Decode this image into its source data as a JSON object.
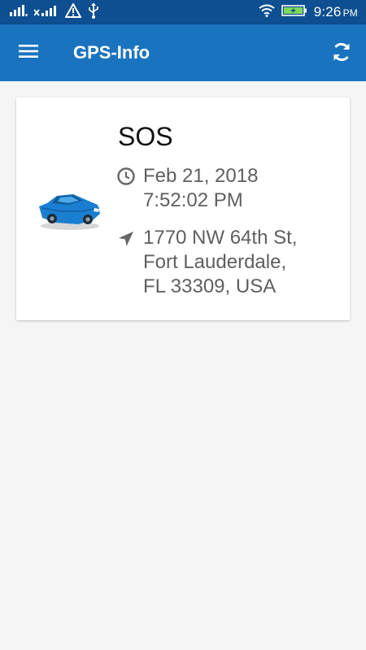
{
  "status_bar": {
    "time": "9:26",
    "ampm": "PM",
    "icons": [
      "signal-icon",
      "signal-x-icon",
      "warning-icon",
      "usb-icon",
      "wifi-icon",
      "battery-charging-icon"
    ]
  },
  "app_bar": {
    "title": "GPS-Info",
    "menu_icon": "hamburger-menu-icon",
    "refresh_icon": "refresh-icon",
    "background": "#1a73be",
    "status_bar_background": "#0d4f91"
  },
  "card": {
    "title": "SOS",
    "vehicle_icon": "car-icon",
    "time_icon": "clock-icon",
    "location_icon": "navigation-arrow-icon",
    "datetime_lines": [
      "Feb 21, 2018",
      "7:52:02 PM"
    ],
    "address_lines": [
      "1770 NW 64th St,",
      "Fort Lauderdale,",
      "FL 33309, USA"
    ],
    "car_color": "#1a7fd1"
  }
}
